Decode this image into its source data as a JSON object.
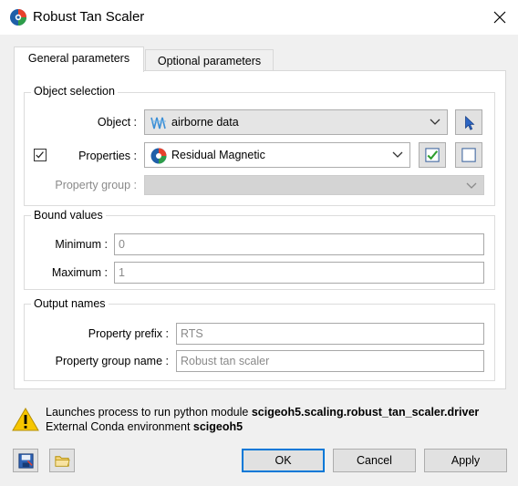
{
  "window": {
    "title": "Robust Tan Scaler",
    "app_icon": "geoscience-app-icon",
    "close_icon": "close-icon"
  },
  "tabs": [
    {
      "label": "General parameters",
      "active": true
    },
    {
      "label": "Optional parameters",
      "active": false
    }
  ],
  "object_selection": {
    "title": "Object selection",
    "object_label": "Object :",
    "object_value": "airborne data",
    "object_icon": "survey-lines-icon",
    "pick_icon": "cursor-pointer-icon",
    "properties_label": "Properties :",
    "properties_checked": true,
    "properties_value": "Residual Magnetic",
    "properties_icon": "data-property-icon",
    "select_all_icon": "check-all-icon",
    "clear_icon": "uncheck-all-icon",
    "property_group_label": "Property group :",
    "property_group_value": ""
  },
  "bound_values": {
    "title": "Bound values",
    "minimum_label": "Minimum :",
    "minimum_placeholder": "0",
    "maximum_label": "Maximum :",
    "maximum_placeholder": "1"
  },
  "output_names": {
    "title": "Output names",
    "prefix_label": "Property prefix :",
    "prefix_placeholder": "RTS",
    "group_name_label": "Property group name :",
    "group_name_placeholder": "Robust tan scaler"
  },
  "info": {
    "line1_prefix": "Launches process to run python module ",
    "line1_module": "scigeoh5.scaling.robust_tan_scaler.driver",
    "line2_prefix": "External Conda environment ",
    "line2_env": "scigeoh5",
    "warning_icon": "warning-icon",
    "warning_color": "#f7c600"
  },
  "footer": {
    "save_icon": "save-settings-icon",
    "open_icon": "open-folder-icon",
    "ok_label": "OK",
    "cancel_label": "Cancel",
    "apply_label": "Apply"
  },
  "colors": {
    "accent": "#0078d7",
    "window_bg": "#f0f0f0",
    "panel_bg": "#ffffff"
  }
}
